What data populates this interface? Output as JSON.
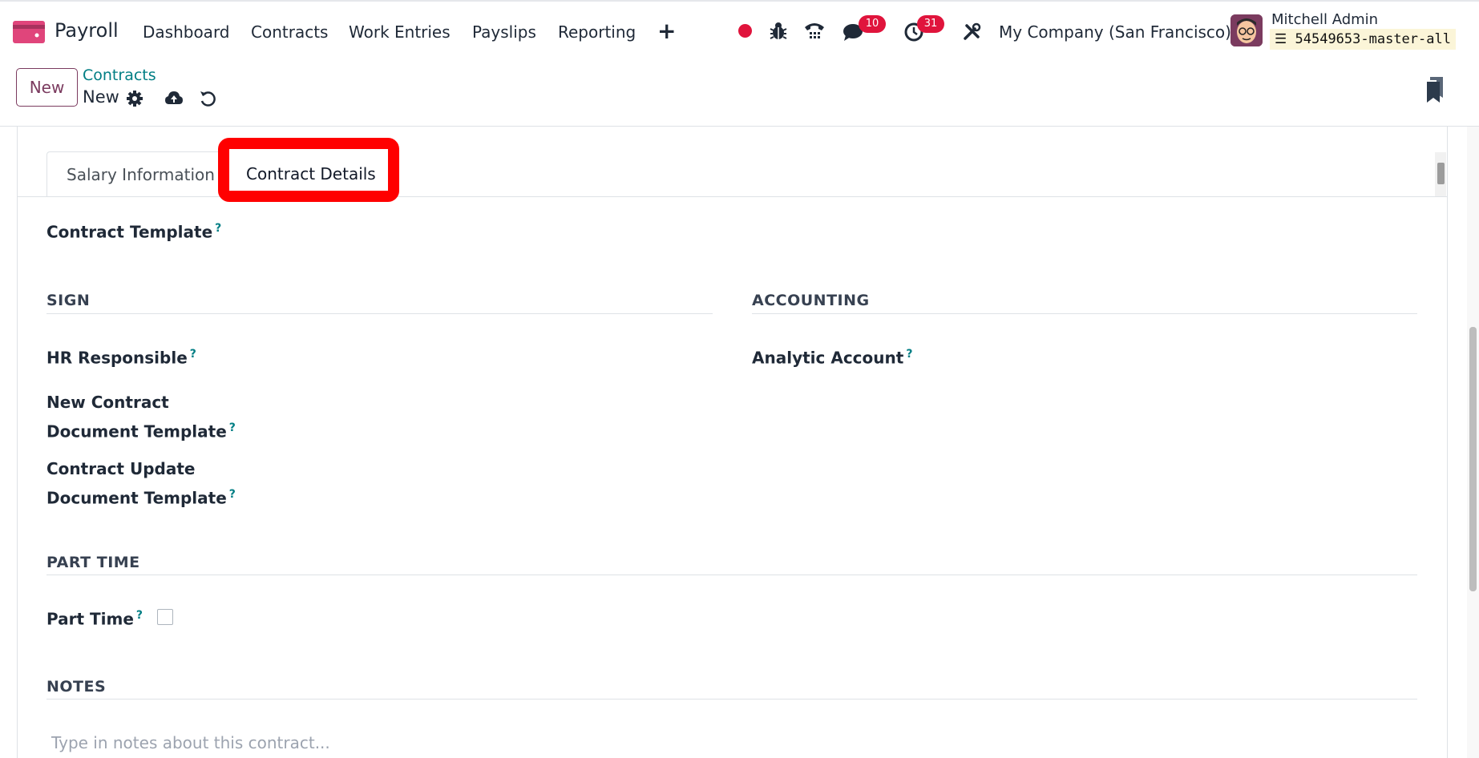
{
  "navbar": {
    "app_name": "Payroll",
    "menu": [
      "Dashboard",
      "Contracts",
      "Work Entries",
      "Payslips",
      "Reporting"
    ],
    "messages_badge": "10",
    "activities_badge": "31",
    "company": "My Company (San Francisco)",
    "user_name": "Mitchell Admin",
    "database": "54549653-master-all"
  },
  "control": {
    "new_button": "New",
    "breadcrumb": "Contracts",
    "record_name": "New"
  },
  "tabs": [
    "Salary Information",
    "Contract Details"
  ],
  "form": {
    "contract_template": "Contract Template",
    "sign_section": "SIGN",
    "accounting_section": "ACCOUNTING",
    "hr_responsible": "HR Responsible",
    "analytic_account": "Analytic Account",
    "new_contract_doc_line1": "New Contract",
    "new_contract_doc_line2": "Document Template",
    "update_doc_line1": "Contract Update",
    "update_doc_line2": "Document Template",
    "part_time_section": "PART TIME",
    "part_time": "Part Time",
    "notes_section": "NOTES",
    "notes_placeholder": "Type in notes about this contract...",
    "help_mark": "?"
  },
  "colors": {
    "accent": "#7b3b5f",
    "link": "#017e84",
    "badge": "#e0143c",
    "highlight": "#ff0000"
  }
}
